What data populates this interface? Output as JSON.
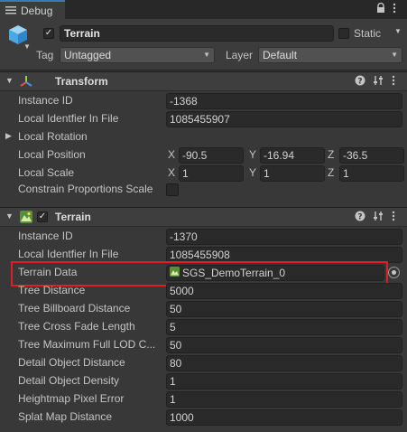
{
  "tab": {
    "label": "Debug",
    "icon": "list-icon"
  },
  "window_controls": {
    "lock": "lock-icon",
    "menu": "kebab-menu-icon"
  },
  "header": {
    "object_icon": "cube-icon",
    "active": true,
    "name": "Terrain",
    "static_label": "Static",
    "static_checked": false,
    "tag_label": "Tag",
    "tag_value": "Untagged",
    "layer_label": "Layer",
    "layer_value": "Default"
  },
  "transform": {
    "title": "Transform",
    "instance_id_label": "Instance ID",
    "instance_id": "-1368",
    "local_identifier_label": "Local Identfier In File",
    "local_identifier": "1085455907",
    "local_rotation_label": "Local Rotation",
    "local_position_label": "Local Position",
    "local_position": {
      "x": "-90.5",
      "y": "-16.94",
      "z": "-36.5"
    },
    "local_scale_label": "Local Scale",
    "local_scale": {
      "x": "1",
      "y": "1",
      "z": "1"
    },
    "constrain_label": "Constrain Proportions Scale",
    "axis_x": "X",
    "axis_y": "Y",
    "axis_z": "Z"
  },
  "terrain": {
    "title": "Terrain",
    "enabled": true,
    "rows": [
      {
        "label": "Instance ID",
        "value": "-1370"
      },
      {
        "label": "Local Identfier In File",
        "value": "1085455908"
      },
      {
        "label": "Terrain Data",
        "value": "SGS_DemoTerrain_0"
      },
      {
        "label": "Tree Distance",
        "value": "5000"
      },
      {
        "label": "Tree Billboard Distance",
        "value": "50"
      },
      {
        "label": "Tree Cross Fade Length",
        "value": "5"
      },
      {
        "label": "Tree Maximum Full LOD C...",
        "value": "50"
      },
      {
        "label": "Detail Object Distance",
        "value": "80"
      },
      {
        "label": "Detail Object Density",
        "value": "1"
      },
      {
        "label": "Heightmap Pixel Error",
        "value": "1"
      },
      {
        "label": "Splat Map Distance",
        "value": "1000"
      }
    ]
  },
  "colors": {
    "accent": "#3a79bb",
    "highlight": "#e02020",
    "background": "#383838"
  }
}
